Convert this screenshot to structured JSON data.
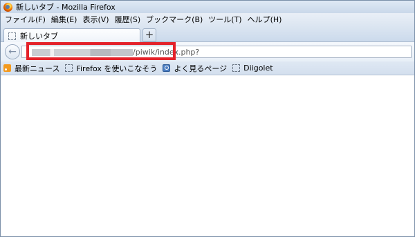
{
  "window": {
    "title": "新しいタブ - Mozilla Firefox"
  },
  "menubar": {
    "items": [
      {
        "label": "ファイル(F)"
      },
      {
        "label": "編集(E)"
      },
      {
        "label": "表示(V)"
      },
      {
        "label": "履歴(S)"
      },
      {
        "label": "ブックマーク(B)"
      },
      {
        "label": "ツール(T)"
      },
      {
        "label": "ヘルプ(H)"
      }
    ]
  },
  "tabs": [
    {
      "label": "新しいタブ",
      "icon": "blank-page-icon",
      "active": true
    }
  ],
  "newtab": {
    "label": "+"
  },
  "navbar": {
    "back_glyph": "←",
    "url_visible": "/piwik/index.php?",
    "url_prefix_redacted": true,
    "highlight_color": "#e4222a"
  },
  "bookmarks": {
    "items": [
      {
        "label": "最新ニュース",
        "icon": "rss-icon"
      },
      {
        "label": "Firefox を使いこなそう",
        "icon": "blank-page-icon"
      },
      {
        "label": "よく見るページ",
        "icon": "search-icon"
      },
      {
        "label": "Diigolet",
        "icon": "blank-page-icon"
      }
    ]
  }
}
